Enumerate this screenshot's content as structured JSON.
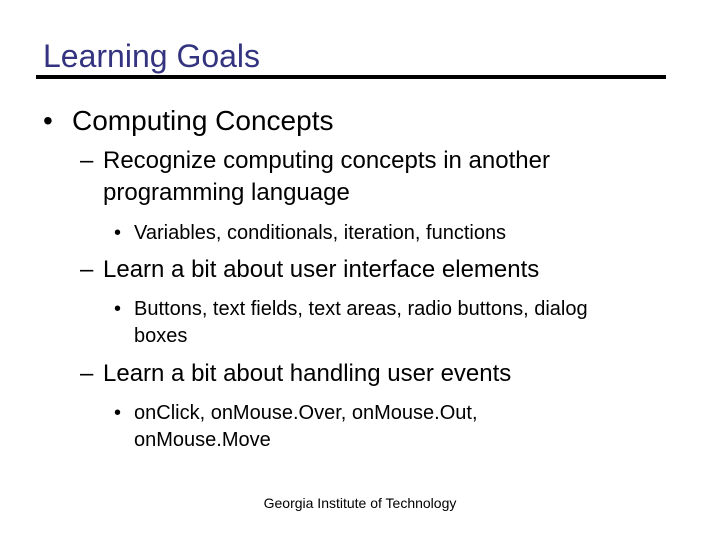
{
  "slide": {
    "title": "Learning Goals",
    "title_color": "#333380",
    "bullet_l1": "•",
    "bullet_l2": "–",
    "bullet_l3": "•",
    "items": [
      {
        "text": "Computing Concepts",
        "subitems": [
          {
            "lines": [
              "Recognize computing concepts in another",
              "programming language"
            ],
            "details": [
              {
                "lines": [
                  "Variables, conditionals, iteration, functions"
                ]
              }
            ]
          },
          {
            "lines": [
              "Learn a bit about user interface elements"
            ],
            "details": [
              {
                "lines": [
                  "Buttons, text fields, text areas, radio buttons, dialog",
                  "boxes"
                ]
              }
            ]
          },
          {
            "lines": [
              "Learn a bit about handling user events"
            ],
            "details": [
              {
                "lines": [
                  "onClick, onMouse.Over, onMouse.Out,",
                  "onMouse.Move"
                ]
              }
            ]
          }
        ]
      }
    ],
    "footer": "Georgia Institute of Technology"
  }
}
